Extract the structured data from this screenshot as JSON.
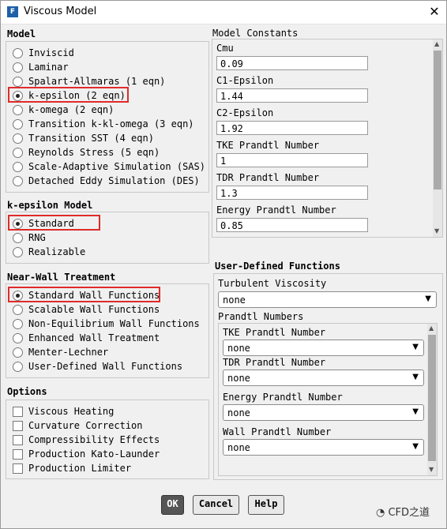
{
  "window": {
    "title": "Viscous Model",
    "app_letter": "F",
    "close": "✕"
  },
  "model": {
    "title": "Model",
    "options": [
      "Inviscid",
      "Laminar",
      "Spalart-Allmaras (1 eqn)",
      "k-epsilon (2 eqn)",
      "k-omega (2 eqn)",
      "Transition k-kl-omega (3 eqn)",
      "Transition SST (4 eqn)",
      "Reynolds Stress (5 eqn)",
      "Scale-Adaptive Simulation (SAS)",
      "Detached Eddy Simulation (DES)"
    ],
    "selected": "k-epsilon (2 eqn)"
  },
  "kemodel": {
    "title": "k-epsilon Model",
    "options": [
      "Standard",
      "RNG",
      "Realizable"
    ],
    "selected": "Standard"
  },
  "nearwall": {
    "title": "Near-Wall Treatment",
    "options": [
      "Standard Wall Functions",
      "Scalable Wall Functions",
      "Non-Equilibrium Wall Functions",
      "Enhanced Wall Treatment",
      "Menter-Lechner",
      "User-Defined Wall Functions"
    ],
    "selected": "Standard Wall Functions"
  },
  "options": {
    "title": "Options",
    "items": [
      "Viscous Heating",
      "Curvature Correction",
      "Compressibility Effects",
      "Production Kato-Launder",
      "Production Limiter"
    ]
  },
  "constants": {
    "title": "Model Constants",
    "items": [
      {
        "label": "Cmu",
        "value": "0.09"
      },
      {
        "label": "C1-Epsilon",
        "value": "1.44"
      },
      {
        "label": "C2-Epsilon",
        "value": "1.92"
      },
      {
        "label": "TKE Prandtl Number",
        "value": "1"
      },
      {
        "label": "TDR Prandtl Number",
        "value": "1.3"
      },
      {
        "label": "Energy Prandtl Number",
        "value": "0.85"
      }
    ]
  },
  "udf": {
    "title": "User-Defined Functions",
    "turb_label": "Turbulent Viscosity",
    "turb_value": "none",
    "prandtl_title": "Prandtl Numbers",
    "items": [
      {
        "label": "TKE Prandtl Number",
        "value": "none"
      },
      {
        "label": "TDR Prandtl Number",
        "value": "none"
      },
      {
        "label": "Energy Prandtl Number",
        "value": "none"
      },
      {
        "label": "Wall Prandtl Number",
        "value": "none"
      }
    ]
  },
  "buttons": {
    "ok": "OK",
    "cancel": "Cancel",
    "help": "Help"
  },
  "watermark": "CFD之道",
  "colors": {
    "highlight": "#e02b2b",
    "ok_bg": "#555555"
  }
}
